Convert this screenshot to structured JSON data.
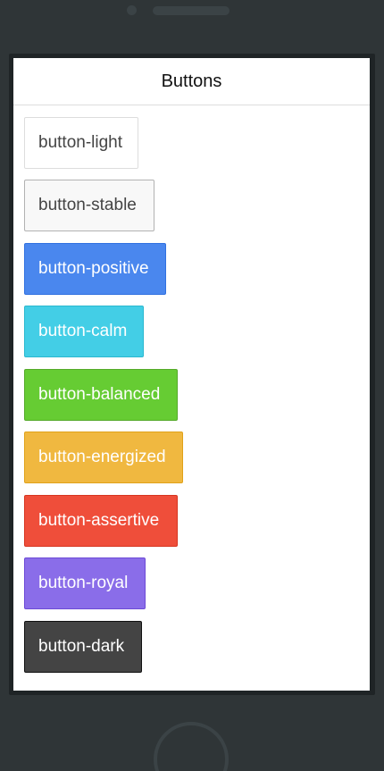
{
  "header": {
    "title": "Buttons"
  },
  "buttons": [
    {
      "label": "button-light",
      "style": "light",
      "background": "#ffffff",
      "text_color": "#444444"
    },
    {
      "label": "button-stable",
      "style": "stable",
      "background": "#f8f8f8",
      "text_color": "#444444"
    },
    {
      "label": "button-positive",
      "style": "positive",
      "background": "#4a87ee",
      "text_color": "#ffffff"
    },
    {
      "label": "button-calm",
      "style": "calm",
      "background": "#43cee6",
      "text_color": "#ffffff"
    },
    {
      "label": "button-balanced",
      "style": "balanced",
      "background": "#66cc33",
      "text_color": "#ffffff"
    },
    {
      "label": "button-energized",
      "style": "energized",
      "background": "#f0b840",
      "text_color": "#ffffff"
    },
    {
      "label": "button-assertive",
      "style": "assertive",
      "background": "#ef4e3a",
      "text_color": "#ffffff"
    },
    {
      "label": "button-royal",
      "style": "royal",
      "background": "#8a6de9",
      "text_color": "#ffffff"
    },
    {
      "label": "button-dark",
      "style": "dark",
      "background": "#444444",
      "text_color": "#ffffff"
    }
  ],
  "device": {
    "frame_color": "#2f3537",
    "home_button_icon": "home-button-ring"
  }
}
